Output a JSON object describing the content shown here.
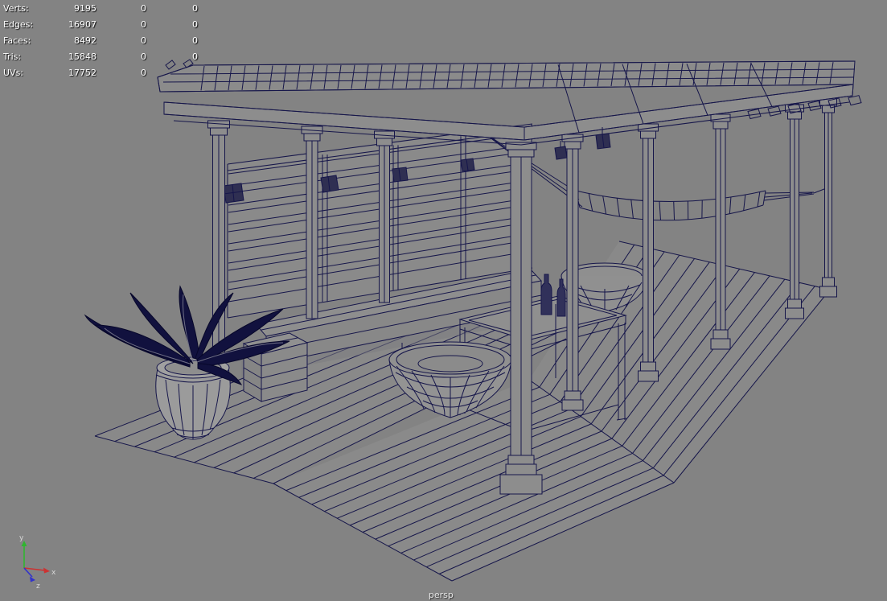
{
  "hud": {
    "rows": [
      {
        "label": "Verts:",
        "total": "9195",
        "col2": "0",
        "col3": "0"
      },
      {
        "label": "Edges:",
        "total": "16907",
        "col2": "0",
        "col3": "0"
      },
      {
        "label": "Faces:",
        "total": "8492",
        "col2": "0",
        "col3": "0"
      },
      {
        "label": "Tris:",
        "total": "15848",
        "col2": "0",
        "col3": "0"
      },
      {
        "label": "UVs:",
        "total": "17752",
        "col2": "0",
        "col3": "0"
      }
    ]
  },
  "viewport": {
    "camera_label": "persp"
  },
  "axis_gizmo": {
    "x_label": "x",
    "y_label": "y",
    "z_label": "z"
  },
  "colors": {
    "background": "#838383",
    "wireframe": "#16164a",
    "hud_text": "#ffffff",
    "camera_label_text": "#e8e8e8",
    "axis_x": "#cc3232",
    "axis_y": "#2fb52f",
    "axis_z": "#3232cc"
  }
}
